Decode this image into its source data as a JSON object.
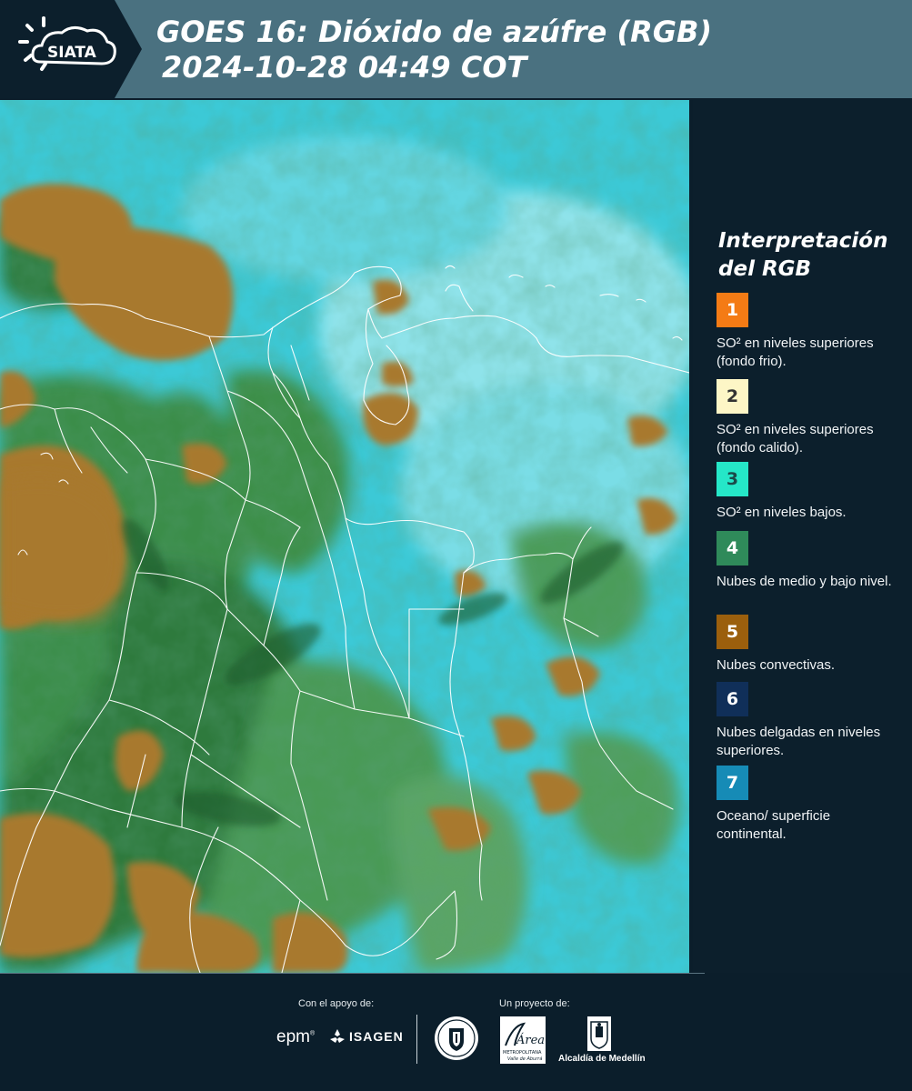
{
  "header": {
    "logo_text": "SIATA",
    "title_line1": "GOES 16: Dióxido de azúfre (RGB)",
    "title_line2": "2024-10-28 04:49 COT",
    "background": "#4a7180",
    "logo_background": "#0c1f2c"
  },
  "map": {
    "description_icon": "satellite-rgb-image",
    "colors": {
      "sky_cyan": "#3cc9d6",
      "pale_cyan": "#7fdfe6",
      "green_cloud": "#3f8f45",
      "dark_green": "#2a6a34",
      "brown_convective": "#a8792e",
      "border_lines": "#ffffff"
    }
  },
  "legend": {
    "title": "Interpretación del RGB",
    "items": [
      {
        "number": "1",
        "color": "#f47b15",
        "text_color": "#ffffff",
        "label": "SO² en niveles superiores (fondo frio)."
      },
      {
        "number": "2",
        "color": "#fdf6c6",
        "text_color": "#333333",
        "label": "SO² en niveles superiores (fondo calido)."
      },
      {
        "number": "3",
        "color": "#25e7c8",
        "text_color": "#1b4a4a",
        "label": "SO² en niveles bajos."
      },
      {
        "number": "4",
        "color": "#2f8a5a",
        "text_color": "#ffffff",
        "label": "Nubes de medio y bajo nivel."
      },
      {
        "number": "5",
        "color": "#9b5f0d",
        "text_color": "#ffffff",
        "label": "Nubes convectivas."
      },
      {
        "number": "6",
        "color": "#102f59",
        "text_color": "#ffffff",
        "label": "Nubes delgadas en niveles superiores."
      },
      {
        "number": "7",
        "color": "#168bb6",
        "text_color": "#ffffff",
        "label": "Oceano/ superficie continental."
      }
    ]
  },
  "footer": {
    "support_label": "Con el apoyo de:",
    "project_label": "Un proyecto de:",
    "sponsors": [
      "epm",
      "ISAGEN"
    ],
    "partners": [
      "Área Metropolitana Valle de Aburrá",
      "Alcaldía de Medellín"
    ],
    "area_logo_text": "Área",
    "area_logo_sub1": "METROPOLITANA",
    "area_logo_sub2": "Valle de Aburrá",
    "alcaldia_text": "Alcaldía de Medellín"
  }
}
